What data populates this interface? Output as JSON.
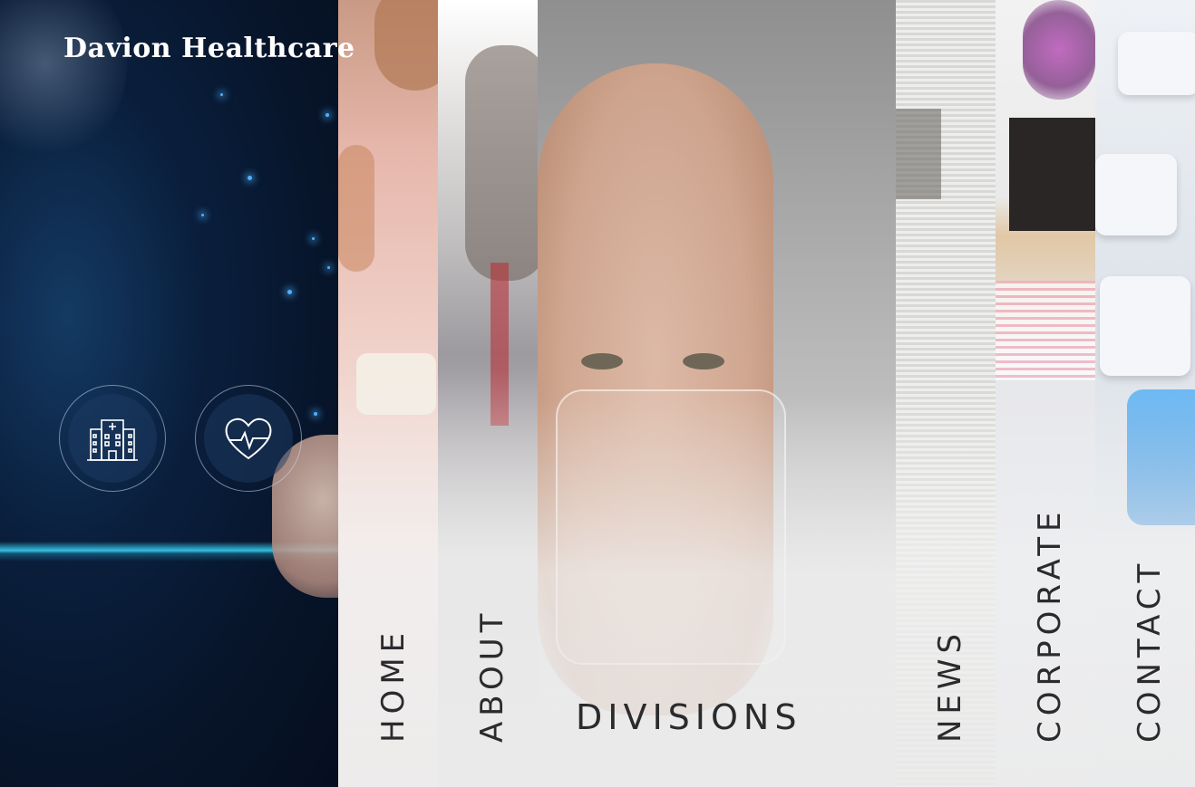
{
  "brand": {
    "name": "Davion Healthcare"
  },
  "hero_icons": [
    {
      "name": "building-icon"
    },
    {
      "name": "heart-pulse-icon"
    }
  ],
  "nav": {
    "home": "HOME",
    "about": "ABOUT",
    "divisions": "DIVISIONS",
    "news": "NEWS",
    "corporate": "CORPORATE",
    "contact": "CONTACT"
  },
  "colors": {
    "nav_text": "#2b2b2e",
    "left_panel_bg": "#0a1f3d",
    "laser_accent": "#3cdcff",
    "star_dot": "#4fb0ff"
  }
}
